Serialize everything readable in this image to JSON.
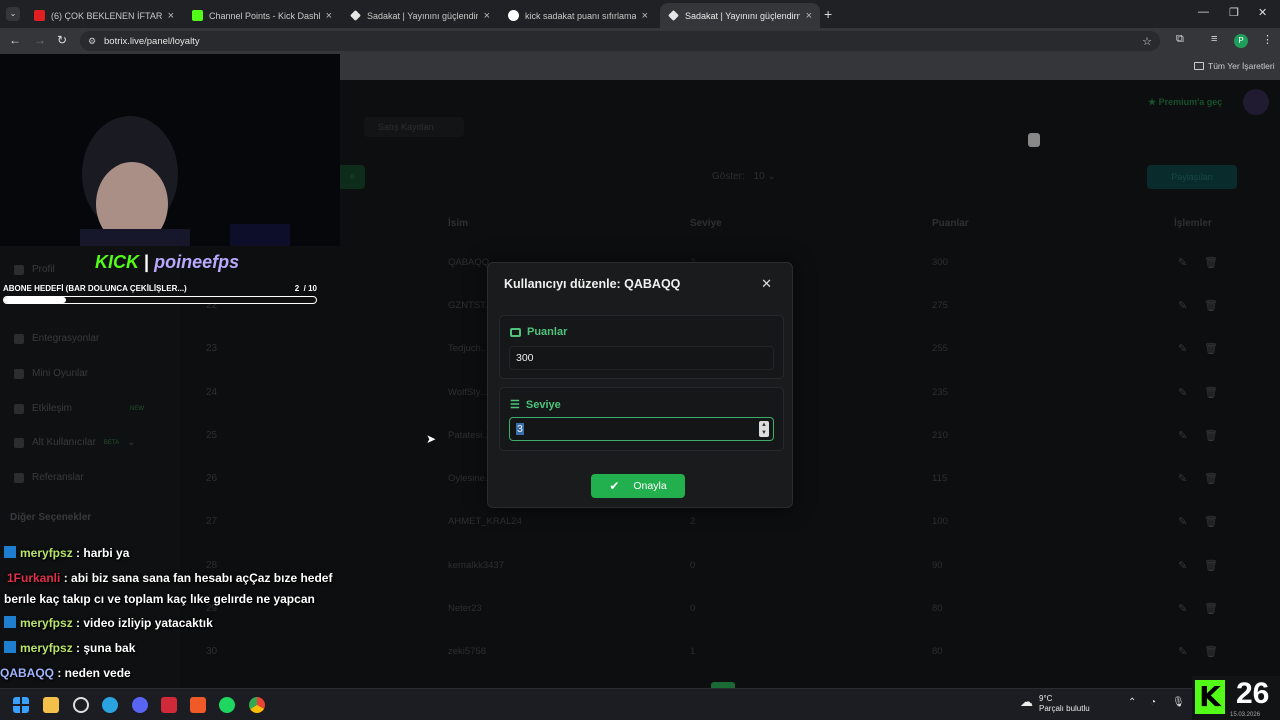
{
  "browser": {
    "tabs": [
      {
        "label": "(6) ÇOK BEKLENEN İFTAR! | Alp..."
      },
      {
        "label": "Channel Points - Kick Dashboar..."
      },
      {
        "label": "Sadakat | Yayınını güçlendirmek..."
      },
      {
        "label": "kick sadakat puanı sıfırlama - G..."
      },
      {
        "label": "Sadakat | Yayınını güçlendirmek..."
      }
    ],
    "url": "botrix.live/panel/loyalty",
    "bookmarks_label": "Tüm Yer İşaretleri",
    "profile_initial": "P"
  },
  "page": {
    "premium_label": "Premium'a geç",
    "tab_label": "Satış Kayıtları",
    "show_label": "Göster:",
    "show_value": "10",
    "export_label": "Paylaşılan",
    "columns": {
      "name": "İsim",
      "level": "Seviye",
      "points": "Puanlar",
      "actions": "İşlemler"
    },
    "rows": [
      {
        "num": "",
        "name": "QABAQQ",
        "level": "3",
        "points": "300"
      },
      {
        "num": "22",
        "name": "GZNTST...",
        "level": "",
        "points": "275"
      },
      {
        "num": "23",
        "name": "Tedjuch...",
        "level": "",
        "points": "255"
      },
      {
        "num": "24",
        "name": "WolfSty...",
        "level": "",
        "points": "235"
      },
      {
        "num": "25",
        "name": "Patatesi...",
        "level": "",
        "points": "210"
      },
      {
        "num": "26",
        "name": "Oylesine...",
        "level": "",
        "points": "115"
      },
      {
        "num": "27",
        "name": "AHMET_KRAL24",
        "level": "2",
        "points": "100"
      },
      {
        "num": "28",
        "name": "kemalkk3437",
        "level": "0",
        "points": "90"
      },
      {
        "num": "29",
        "name": "Neter23",
        "level": "0",
        "points": "80"
      },
      {
        "num": "30",
        "name": "zeki5758",
        "level": "1",
        "points": "80"
      }
    ],
    "sidebar": [
      {
        "label": "Profil"
      },
      {
        "label": "Entegrasyonlar"
      },
      {
        "label": "Mini Oyunlar"
      },
      {
        "label": "Etkileşim",
        "badge": "NEW"
      },
      {
        "label": "Alt Kullanıcılar",
        "badge": "BETA"
      },
      {
        "label": "Referanslar"
      }
    ],
    "sidebar_section": "Diğer Seçenekler"
  },
  "modal": {
    "title": "Kullanıcıyı düzenle: QABAQQ",
    "points_label": "Puanlar",
    "points_value": "300",
    "level_label": "Seviye",
    "level_value": "3",
    "confirm_label": "Onayla"
  },
  "stream": {
    "platform": "KICK",
    "channel": "poineefps",
    "goal_label": "ABONE HEDEFİ (BAR DOLUNCA ÇEKİLİŞLER...)",
    "goal_current": "2",
    "goal_total": "/ 10",
    "goal_fraction": 0.2,
    "chat": [
      {
        "user": "meryfpsz",
        "message": ": harbi ya",
        "color": "#b7e36b"
      },
      {
        "user": "1Furkanli",
        "message": ": abi biz sana sana fan hesabı açÇaz bıze hedef",
        "color": "#e0304a"
      },
      {
        "user": "",
        "message": "berıle kaç takıp cı ve toplam kaç lıke gelırde ne yapcan",
        "color": "#ffffff"
      },
      {
        "user": "meryfpsz",
        "message": ": video izliyip yatacaktık",
        "color": "#b7e36b"
      },
      {
        "user": "meryfpsz",
        "message": ": şuna bak",
        "color": "#b7e36b"
      },
      {
        "user": "QABAQQ",
        "message": ": neden vede",
        "color": "#9fb4ff"
      }
    ]
  },
  "taskbar": {
    "weather_temp": "9°C",
    "weather_desc": "Parçalı bulutlu",
    "subs_count": "26",
    "date": "15.03.2026"
  },
  "colors": {
    "accent_green": "#22b04f",
    "label_green": "#4ec37a"
  }
}
